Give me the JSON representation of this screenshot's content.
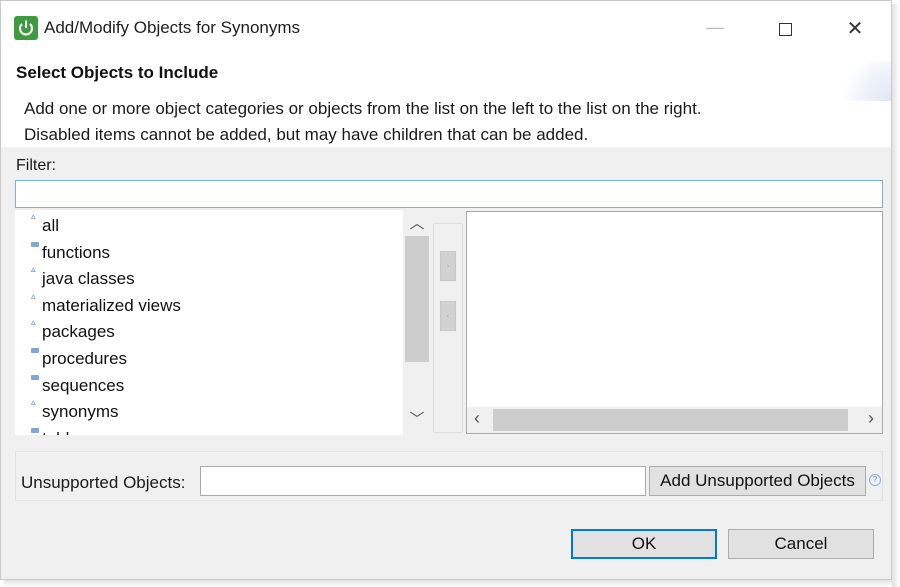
{
  "window": {
    "title": "Add/Modify Objects for Synonyms",
    "minimize_glyph": "—",
    "close_glyph": "✕"
  },
  "header": {
    "section_title": "Select Objects to Include",
    "description_line1": "Add one or more object categories or objects from the list on the left to the list on the right.",
    "description_line2": "Disabled items cannot be added, but may have children that can be added."
  },
  "filter": {
    "label": "Filter:",
    "value": ""
  },
  "object_list": {
    "items": [
      {
        "label": "all",
        "icon": "triangle-icon"
      },
      {
        "label": "functions",
        "icon": "folder-icon"
      },
      {
        "label": "java classes",
        "icon": "triangle-icon"
      },
      {
        "label": "materialized views",
        "icon": "triangle-icon"
      },
      {
        "label": "packages",
        "icon": "triangle-icon"
      },
      {
        "label": "procedures",
        "icon": "folder-icon"
      },
      {
        "label": "sequences",
        "icon": "folder-icon"
      },
      {
        "label": "synonyms",
        "icon": "triangle-icon"
      },
      {
        "label": "tables",
        "icon": "folder-icon"
      }
    ]
  },
  "unsupported": {
    "label": "Unsupported Objects:",
    "value": "",
    "add_button": "Add Unsupported Objects",
    "help_glyph": "?"
  },
  "buttons": {
    "ok": "OK",
    "cancel": "Cancel"
  },
  "colors": {
    "accent": "#0078d7",
    "app_icon": "#3f9b3f",
    "panel_bg": "#f0f0f0"
  }
}
